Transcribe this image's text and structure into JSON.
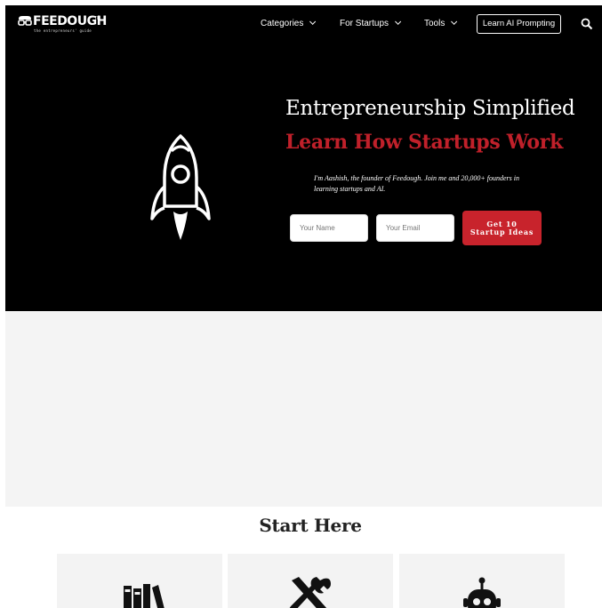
{
  "brand": {
    "name": "FEEDOUGH",
    "tagline": "the entrepreneurs' guide",
    "trademark": "TM"
  },
  "nav": {
    "items": [
      {
        "label": "Categories",
        "has_dropdown": true
      },
      {
        "label": "For Startups",
        "has_dropdown": true
      },
      {
        "label": "Tools",
        "has_dropdown": true
      }
    ],
    "cta_label": "Learn AI Prompting",
    "search_icon": "search-icon"
  },
  "hero": {
    "title": "Entrepreneurship Simplified",
    "subtitle": "Learn How Startups Work",
    "intro": "I'm Aashish, the founder of Feedough. Join me and 20,000+ founders in learning startups and AI.",
    "name_placeholder": "Your Name",
    "email_placeholder": "Your Email",
    "submit_label": "Get 10 Startup Ideas",
    "icon": "rocket-icon"
  },
  "start_here": {
    "title": "Start Here",
    "cards": [
      {
        "icon": "books-icon"
      },
      {
        "icon": "tools-icon"
      },
      {
        "icon": "robot-icon"
      }
    ]
  },
  "colors": {
    "hero_bg": "#000000",
    "accent_red": "#c0202a",
    "band_gray": "#f4f4f4",
    "card_gray": "#f3f3f3"
  }
}
